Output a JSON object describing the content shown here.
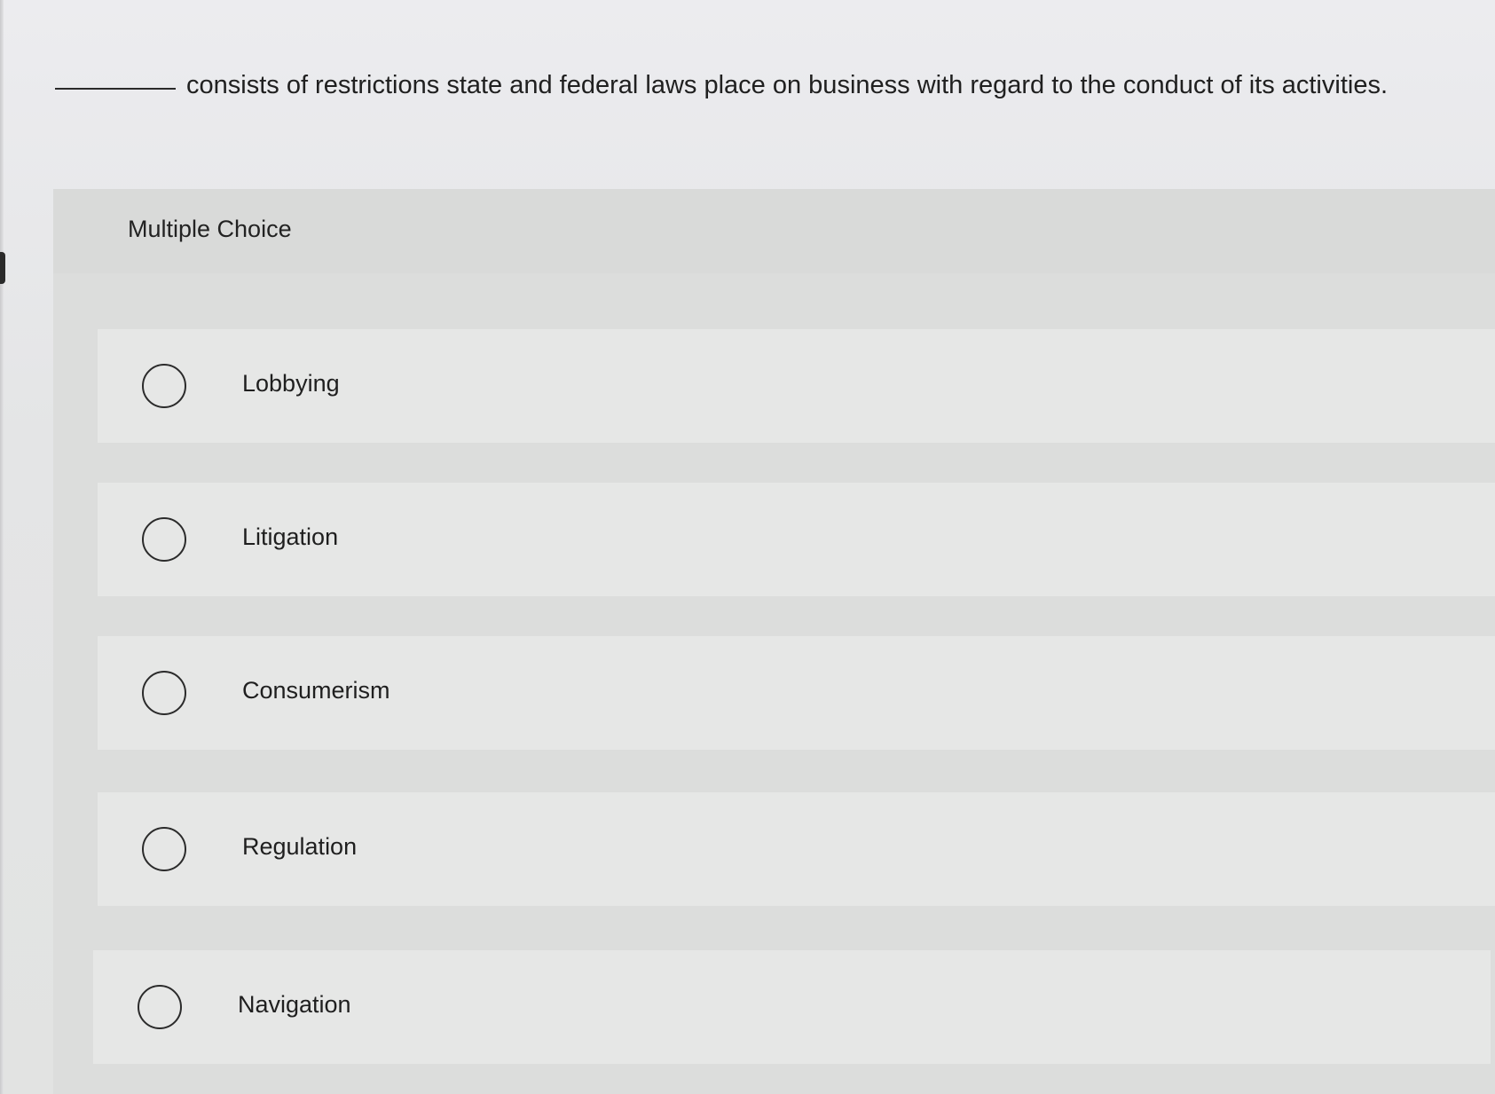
{
  "question": {
    "text": "consists of restrictions state and federal laws place on business with regard to the conduct of its activities."
  },
  "multiple_choice": {
    "label": "Multiple Choice",
    "options": [
      {
        "label": "Lobbying",
        "selected": false
      },
      {
        "label": "Litigation",
        "selected": false
      },
      {
        "label": "Consumerism",
        "selected": false
      },
      {
        "label": "Regulation",
        "selected": false
      },
      {
        "label": "Navigation",
        "selected": false
      }
    ]
  },
  "colors": {
    "background": "#e6e6e8",
    "panel": "#dcdddc",
    "option_row": "#e6e7e6",
    "text": "#1f1f1f"
  },
  "icons": {
    "radio": "radio-unchecked-icon"
  }
}
